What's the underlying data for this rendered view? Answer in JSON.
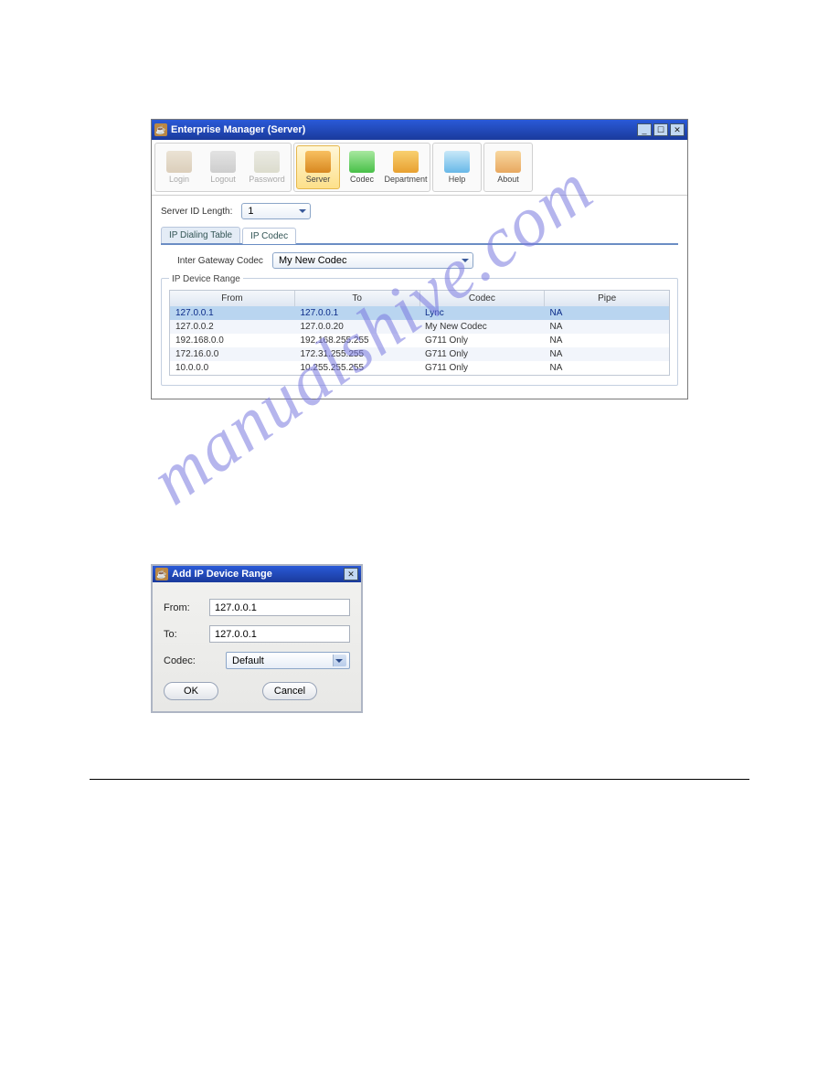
{
  "watermark": "manualshive.com",
  "win1": {
    "title": "Enterprise Manager  (Server)",
    "toolbar": [
      {
        "name": "login-button",
        "label": "Login",
        "iconCls": "login",
        "state": "disabled"
      },
      {
        "name": "logout-button",
        "label": "Logout",
        "iconCls": "logout",
        "state": "disabled"
      },
      {
        "name": "password-button",
        "label": "Password",
        "iconCls": "password",
        "state": "disabled"
      },
      {
        "name": "server-button",
        "label": "Server",
        "iconCls": "server",
        "state": "active"
      },
      {
        "name": "codec-button",
        "label": "Codec",
        "iconCls": "codec",
        "state": ""
      },
      {
        "name": "department-button",
        "label": "Department",
        "iconCls": "department",
        "state": ""
      },
      {
        "name": "help-button",
        "label": "Help",
        "iconCls": "help",
        "state": ""
      },
      {
        "name": "about-button",
        "label": "About",
        "iconCls": "about",
        "state": ""
      }
    ],
    "serverIdLength": {
      "label": "Server ID Length:",
      "value": "1"
    },
    "tabs": {
      "dialing": "IP Dialing Table",
      "codec": "IP Codec"
    },
    "interGateway": {
      "label": "Inter Gateway Codec",
      "value": "My New Codec"
    },
    "deviceRange": {
      "legend": "IP Device Range",
      "headers": {
        "from": "From",
        "to": "To",
        "codec": "Codec",
        "pipe": "Pipe"
      },
      "rows": [
        {
          "from": "127.0.0.1",
          "to": "127.0.0.1",
          "codec": "Lync",
          "pipe": "NA",
          "selected": true
        },
        {
          "from": "127.0.0.2",
          "to": "127.0.0.20",
          "codec": "My New Codec",
          "pipe": "NA",
          "selected": false
        },
        {
          "from": "192.168.0.0",
          "to": "192.168.255.255",
          "codec": "G711 Only",
          "pipe": "NA",
          "selected": false
        },
        {
          "from": "172.16.0.0",
          "to": "172.31.255.255",
          "codec": "G711 Only",
          "pipe": "NA",
          "selected": false
        },
        {
          "from": "10.0.0.0",
          "to": "10.255.255.255",
          "codec": "G711 Only",
          "pipe": "NA",
          "selected": false
        }
      ]
    }
  },
  "win2": {
    "title": "Add IP Device Range",
    "fields": {
      "from": {
        "label": "From:",
        "value": "127.0.0.1"
      },
      "to": {
        "label": "To:",
        "value": "127.0.0.1"
      },
      "codec": {
        "label": "Codec:",
        "value": "Default"
      }
    },
    "buttons": {
      "ok": "OK",
      "cancel": "Cancel"
    }
  }
}
